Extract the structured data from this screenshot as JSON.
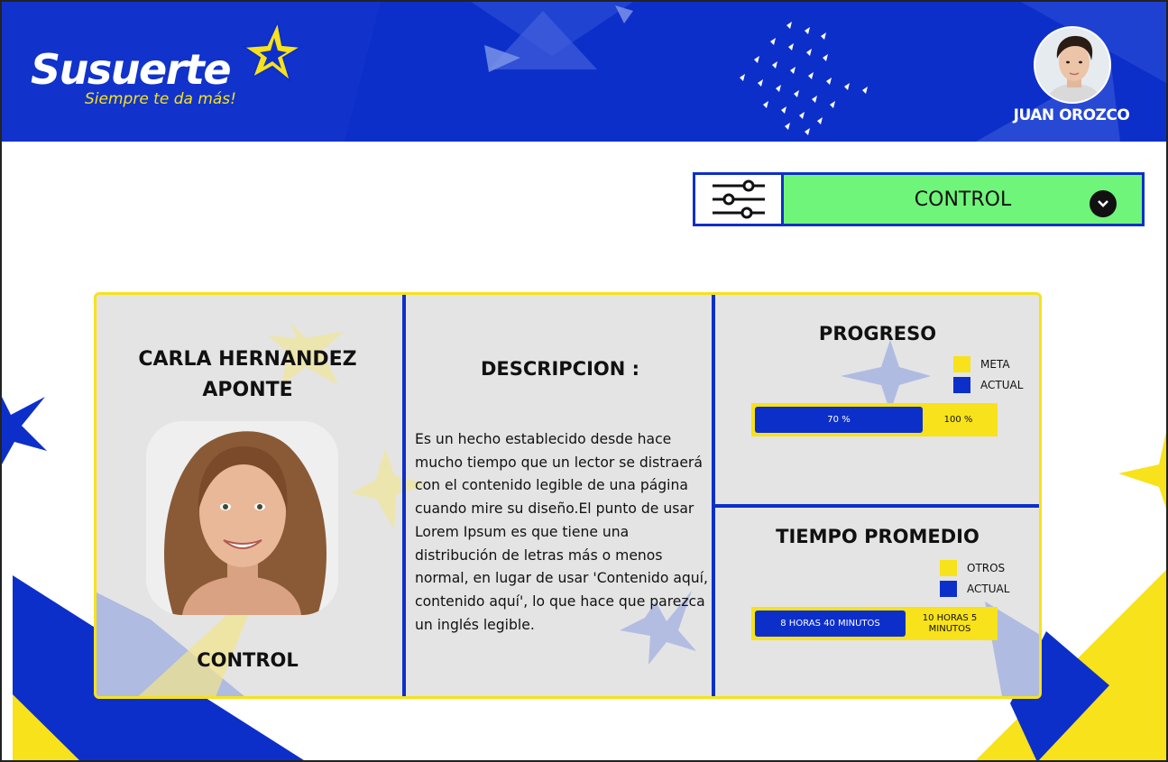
{
  "header": {
    "logo_text": "Susuerte",
    "logo_tagline": "Siempre te da más!",
    "user_name": "JUAN OROZCO"
  },
  "selector": {
    "filter_icon": "sliders-icon",
    "selected": "CONTROL"
  },
  "profile": {
    "name_line1": "CARLA HERNANDEZ",
    "name_line2": "APONTE",
    "role": "CONTROL"
  },
  "description": {
    "title": "DESCRIPCION :",
    "text": "Es un hecho establecido desde hace mucho tiempo que un lector se distraerá con el contenido legible de una página cuando mire su diseño.El punto de usar Lorem Ipsum es que tiene una distribución de letras más o menos normal, en lugar de usar 'Contenido aquí, contenido aquí', lo que hace que parezca un inglés legible."
  },
  "progress": {
    "title": "PROGRESO",
    "legend": [
      {
        "label": "META",
        "color": "#f7e21b"
      },
      {
        "label": "ACTUAL",
        "color": "#0d2fc9"
      }
    ],
    "actual_label": "70 %",
    "goal_label": "100 %",
    "actual_fraction": 0.7
  },
  "average_time": {
    "title": "TIEMPO PROMEDIO",
    "legend": [
      {
        "label": "OTROS",
        "color": "#f7e21b"
      },
      {
        "label": "ACTUAL",
        "color": "#0d2fc9"
      }
    ],
    "actual_label": "8 HORAS 40 MINUTOS",
    "others_label": "10 HORAS 5 MINUTOS",
    "actual_fraction": 0.63
  },
  "colors": {
    "brand_blue": "#0d2fc9",
    "brand_yellow": "#f7e21b",
    "select_green": "#6ff57a"
  }
}
